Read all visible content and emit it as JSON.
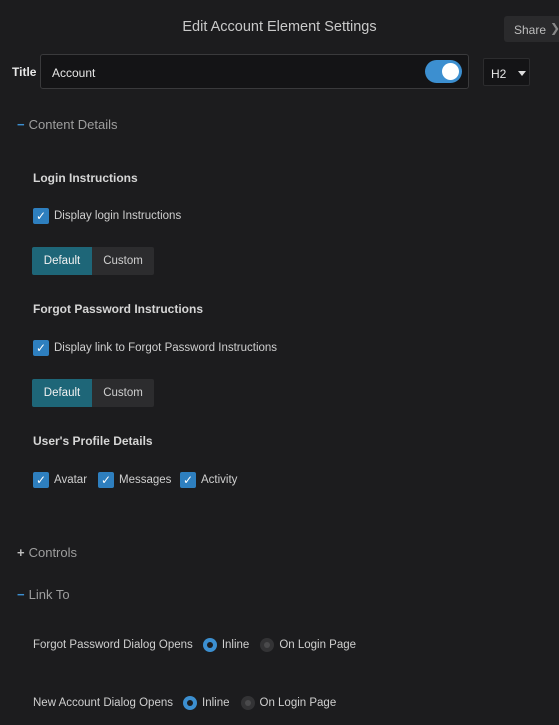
{
  "header": {
    "title": "Edit Account Element Settings",
    "share_label": "Share",
    "share_icon": "chevron-right-icon"
  },
  "title_row": {
    "label": "Title",
    "value": "Account",
    "toggle_on": true,
    "heading_level": "H2"
  },
  "sections": {
    "content_details": {
      "label": "Content Details",
      "expanded": true
    },
    "controls": {
      "label": "Controls",
      "expanded": false
    },
    "link_to": {
      "label": "Link To",
      "expanded": true
    }
  },
  "login_instructions": {
    "heading": "Login Instructions",
    "checkbox_label": "Display login Instructions",
    "checked": true,
    "options": [
      "Default",
      "Custom"
    ],
    "selected": "Default"
  },
  "forgot_password": {
    "heading": "Forgot Password Instructions",
    "checkbox_label": "Display link to Forgot Password Instructions",
    "checked": true,
    "options": [
      "Default",
      "Custom"
    ],
    "selected": "Default"
  },
  "profile_details": {
    "heading": "User's Profile Details",
    "items": [
      {
        "label": "Avatar",
        "checked": true
      },
      {
        "label": "Messages",
        "checked": true
      },
      {
        "label": "Activity",
        "checked": true
      }
    ]
  },
  "link_to": {
    "forgot_dialog": {
      "label": "Forgot Password Dialog Opens",
      "options": [
        "Inline",
        "On Login Page"
      ],
      "selected": "Inline"
    },
    "new_account_dialog": {
      "label": "New Account Dialog Opens",
      "options": [
        "Inline",
        "On Login Page"
      ],
      "selected": "Inline"
    }
  },
  "colors": {
    "accent": "#3c8fd0",
    "segment_active": "#1e6678",
    "background": "#1c1c1e"
  }
}
